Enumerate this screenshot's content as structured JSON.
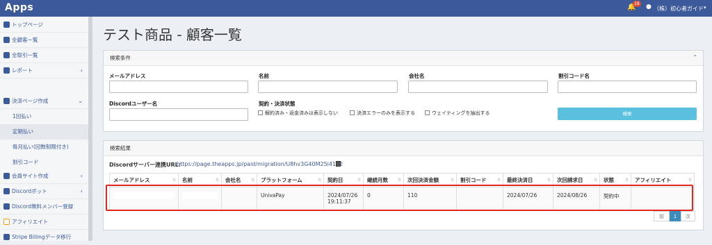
{
  "app": {
    "brand": "Apps"
  },
  "topbar": {
    "notification_count": "18",
    "user_name": "（株）初心者ガイド"
  },
  "sidebar": {
    "items": [
      {
        "label": "トップページ"
      },
      {
        "label": "全顧客一覧"
      },
      {
        "label": "全取引一覧"
      },
      {
        "label": "レポート"
      },
      {
        "label": "決済ページ作成"
      },
      {
        "label": "会員サイト作成"
      },
      {
        "label": "Discordボット"
      },
      {
        "label": "Discord無料メンバー登録"
      },
      {
        "label": "アフィリエイト"
      },
      {
        "label": "Stripe Billingデータ移行"
      }
    ],
    "subitems": [
      {
        "label": "1回払い"
      },
      {
        "label": "定期払い"
      },
      {
        "label": "毎月払い(回数制限付き)"
      },
      {
        "label": "割引コード"
      }
    ]
  },
  "page": {
    "title": "テスト商品 - 顧客一覧"
  },
  "search": {
    "header": "検索条件",
    "email_label": "メールアドレス",
    "name_label": "名前",
    "company_label": "会社名",
    "discount_label": "割引コード名",
    "discord_label": "Discordユーザー名",
    "status_label": "契約・決済状態",
    "check1": "解約済み・返金済みは表示しない",
    "check2": "決済エラーのみを表示する",
    "check3": "ウェイティングを抽出する",
    "button": "検索"
  },
  "results": {
    "header": "検索結果",
    "url_label": "Discordサーバー連携URL:",
    "url": "https://page.theapps.jp/paid/migration/U8hv3G40M25i41d2",
    "columns": [
      "メールアドレス",
      "名前",
      "会社名",
      "プラットフォーム",
      "契約日",
      "継続月数",
      "次回決済金額",
      "割引コード",
      "最終決済日",
      "次回請求日",
      "状態",
      "アフィリエイト"
    ],
    "row": {
      "email": "",
      "name": "",
      "company": "",
      "platform": "UnivaPay",
      "contract_date": "2024/07/26",
      "contract_time": "19:11:37",
      "months": "0",
      "next_amount": "110",
      "discount": "",
      "last_payment": "2024/07/26",
      "next_billing": "2024/08/26",
      "status": "契約中",
      "affiliate": ""
    }
  },
  "pager": {
    "prev": "前",
    "current": "1",
    "next": "次"
  }
}
